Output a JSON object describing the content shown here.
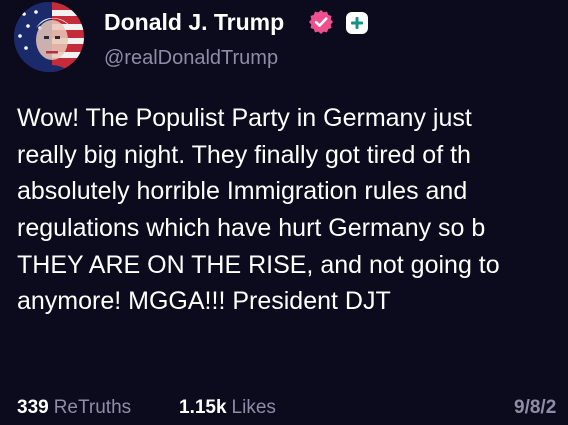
{
  "colors": {
    "background": "#0c0b1d",
    "text_primary": "#ffffff",
    "text_secondary": "#8e8ca7",
    "verified_badge": "#ee4f8f"
  },
  "author": {
    "display_name": "Donald J. Trump",
    "handle": "@realDonaldTrump",
    "avatar_icon": "flag-portrait-avatar",
    "verified_icon": "verified-badge-icon",
    "plus_icon": "plus-icon"
  },
  "post": {
    "lines": [
      "Wow! The Populist Party in Germany just",
      "really big night. They finally got tired of th",
      "absolutely horrible Immigration rules and",
      "regulations which have hurt Germany so b",
      "THEY ARE ON THE RISE, and not going to",
      "anymore! MGGA!!! President DJT"
    ]
  },
  "stats": {
    "retruths_count": "339",
    "retruths_label": "ReTruths",
    "likes_count": "1.15k",
    "likes_label": "Likes",
    "timestamp": "9/8/2"
  }
}
